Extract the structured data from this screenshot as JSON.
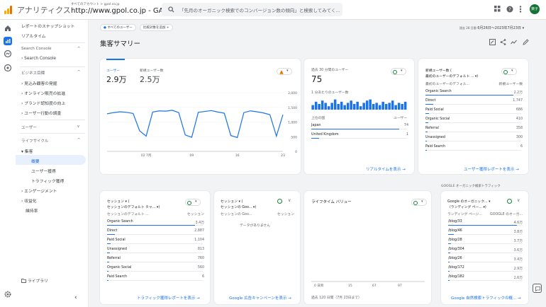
{
  "app": {
    "name": "アナリティクス",
    "account_crumb": "すべてのアカウント > gpol.co.jp",
    "property": "http://www.gpol.co.jp - GA4",
    "search_placeholder": "「先月のオーガニック検索でのコンバージョン数の傾向」と検索してみてく...",
    "avatar_text": "楽子"
  },
  "nav": {
    "snapshot": "レポートのスナップショット",
    "realtime": "リアルタイム",
    "sc_section": "Search Console",
    "sc_item": "Search Console",
    "biz_section": "ビジネス目標",
    "biz_items": [
      "見込み顧客の発掘",
      "オンライン販売の拡進",
      "ブランド認知度の向上",
      "ユーザー行動の調査"
    ],
    "user_section": "ユーザー",
    "lifecycle_section": "ライフサイクル",
    "acquisition": "集客",
    "overview": "概要",
    "user_acq": "ユーザー獲得",
    "traffic_acq": "トラフィック獲得",
    "engagement": "エンゲージメント",
    "monetization": "収益化",
    "retention": "維持率",
    "library": "ライブラリ",
    "collapse": "‹"
  },
  "header": {
    "chip_all_users": "すべてのユーザー",
    "chip_add_compare": "比較対象を追加",
    "title": "集客サマリー",
    "date_prefix": "過去 28 日間",
    "date_range": "6月26日～2023年7月23日"
  },
  "card1": {
    "metric1_label": "ユーザー",
    "metric1_value": "2.9万",
    "metric2_label": "新規ユーザー数",
    "metric2_value": "2.5万",
    "y_ticks": [
      "2,000",
      "1,500",
      "1,000",
      "500",
      "0"
    ],
    "x_ticks": [
      "02 7月",
      "09",
      "16",
      "23"
    ]
  },
  "card2": {
    "title": "過去 30 分間のユーザー",
    "value": "75",
    "sub": "1 分あたりのユーザー数",
    "col1": "上位の国",
    "col2": "ユーザー",
    "rows": [
      {
        "label": "Japan",
        "value": "74"
      },
      {
        "label": "United Kingdom",
        "value": "1"
      }
    ],
    "link": "リアルタイムを表示"
  },
  "card3": {
    "title_line1": "新規ユーザー数 (",
    "title_line2": "最初のユーザーのデフォルト ... ▾)",
    "col1": "最初のユーザーのデフォル...",
    "col2": "新規ユーザー数",
    "rows": [
      {
        "label": "Organic Search",
        "value": "2.2万"
      },
      {
        "label": "Direct",
        "value": "1,747"
      },
      {
        "label": "Paid Social",
        "value": "686"
      },
      {
        "label": "Organic Social",
        "value": "410"
      },
      {
        "label": "Referral",
        "value": "358"
      },
      {
        "label": "Unassigned",
        "value": "300"
      },
      {
        "label": "Paid Search",
        "value": "6"
      }
    ],
    "link": "ユーザー獲得レポートを表示"
  },
  "card4": {
    "title_line1": "セッション ▾ (",
    "title_line2": "セッションのデフォルト チャ... ▾)",
    "col1": "セッションのデフォルト ...",
    "col2": "セッション",
    "rows": [
      {
        "label": "Organic Search",
        "value": "3.4万"
      },
      {
        "label": "Direct",
        "value": "2,887"
      },
      {
        "label": "Paid Social",
        "value": "1,104"
      },
      {
        "label": "Unassigned",
        "value": "813"
      },
      {
        "label": "Referral",
        "value": "760"
      },
      {
        "label": "Organic Social",
        "value": "560"
      },
      {
        "label": "Paid Search",
        "value": "6"
      }
    ],
    "link": "トラフィック獲得レポートを表示"
  },
  "card5": {
    "title_line1": "セッション ▾ (",
    "title_line2": "セッションの Goo... ▾)",
    "col1": "セッションの Goo...",
    "col2": "セッション",
    "empty": "データがありません",
    "link": "Google 広告キャンペーンを表示"
  },
  "card6": {
    "title": "ライフタイム バリュー",
    "x_ticks": [
      "0 日目",
      "15",
      "67",
      "97"
    ],
    "footer": "過去 120 日間（7月 23日まで）"
  },
  "card7": {
    "section_label": "GOOGLE オーガニック検索トラフィック",
    "title_line1": "Google のオーガニック... ▾",
    "title_line2": "（ランディング ペー... ▾)",
    "col1": "ランディング ページ...",
    "col2": "GOOGLE のオーガ...",
    "rows": [
      {
        "label": "/blog/33",
        "value": "4.6万"
      },
      {
        "label": "/blog/46",
        "value": "3.8万"
      },
      {
        "label": "/blog/28",
        "value": "3.7万"
      },
      {
        "label": "/blog/304",
        "value": "3.6万"
      },
      {
        "label": "/blog/26",
        "value": "3.4万"
      },
      {
        "label": "/blog/172",
        "value": "2.9万"
      },
      {
        "label": "/blog/182",
        "value": "2.6万"
      }
    ],
    "link": "Google 自然検索トラフィックの概..."
  },
  "chart_data": [
    {
      "type": "line",
      "ylim": [
        0,
        2000
      ],
      "x": [
        "06-26",
        "06-27",
        "06-28",
        "06-29",
        "06-30",
        "07-01",
        "07-02",
        "07-03",
        "07-04",
        "07-05",
        "07-06",
        "07-07",
        "07-08",
        "07-09",
        "07-10",
        "07-11",
        "07-12",
        "07-13",
        "07-14",
        "07-15",
        "07-16",
        "07-17",
        "07-18",
        "07-19",
        "07-20",
        "07-21",
        "07-22",
        "07-23"
      ],
      "series": [
        {
          "values": [
            1280,
            1320,
            1350,
            1330,
            1290,
            700,
            520,
            1340,
            1380,
            1370,
            1400,
            1320,
            560,
            480,
            1330,
            1360,
            1390,
            1340,
            1300,
            540,
            470,
            1320,
            1380,
            1350,
            1310,
            1250,
            520,
            1250
          ]
        }
      ]
    },
    {
      "type": "bar",
      "values": [
        4,
        7,
        5,
        8,
        6,
        3,
        6,
        9,
        5,
        7,
        4,
        6,
        8,
        5,
        7,
        3,
        6,
        8,
        9,
        5,
        6,
        4,
        7,
        5,
        6,
        8,
        4,
        6,
        5,
        7
      ]
    }
  ]
}
